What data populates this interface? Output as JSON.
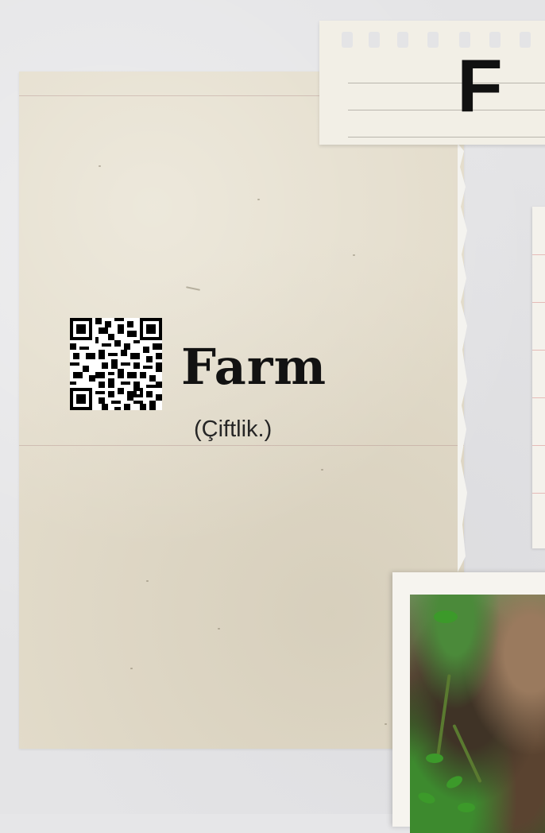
{
  "card": {
    "corner_letter": "F",
    "word": "Farm",
    "translation": "(Çiftlik.)",
    "qr_icon": "qr-code-icon",
    "photo_subject": "plant-sprouts-photo"
  },
  "colors": {
    "background": "#e4e4e6",
    "paper": "#e3dccb",
    "text": "#121212",
    "notepad": "#f2efe6"
  }
}
